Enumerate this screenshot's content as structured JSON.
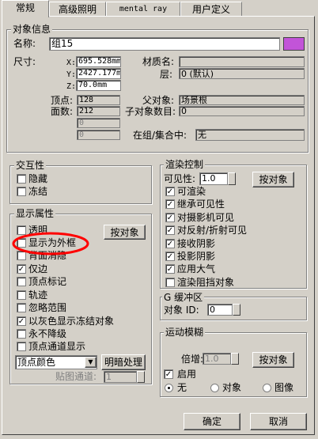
{
  "tabs": [
    "常规",
    "高级照明",
    "mental ray",
    "用户定义"
  ],
  "obj_info": {
    "title": "对象信息",
    "name_label": "名称:",
    "name_value": "组15",
    "swatch_color": "#c254d8",
    "size_label": "尺寸:",
    "x_label": "X:",
    "x_value": "695.528mm",
    "y_label": "Y:",
    "y_value": "2427.177m",
    "z_label": "Z:",
    "z_value": "70.0mm",
    "material_label": "材质名:",
    "material_value": "",
    "layer_label": "层:",
    "layer_value": "0 (默认)",
    "vertices_label": "顶点:",
    "vertices_value": "128",
    "faces_label": "面数:",
    "faces_value": "212",
    "blank1": "0",
    "blank2": "0",
    "parent_label": "父对象:",
    "parent_value": "场景根",
    "children_label": "子对象数目:",
    "children_value": "0",
    "group_label": "在组/集合中:",
    "group_value": "无"
  },
  "interactive": {
    "title": "交互性",
    "hide": "隐藏",
    "freeze": "冻结"
  },
  "display": {
    "title": "显示属性",
    "transparent": "透明",
    "by_object": "按对象",
    "box": "显示为外框",
    "backface": "背面消隐",
    "edges_only": "仅边",
    "vertex_ticks": "顶点标记",
    "trajectory": "轨迹",
    "ignore_extents": "忽略范围",
    "gray_frozen": "以灰色显示冻结对象",
    "never_degrade": "永不降级",
    "vertex_channel": "顶点通道显示",
    "color_select": "顶点颜色",
    "shaded": "明暗处理",
    "map_channel_label": "贴图通道:",
    "map_channel_value": "1"
  },
  "render": {
    "title": "渲染控制",
    "visibility_label": "可见性:",
    "visibility_value": "1.0",
    "by_object": "按对象",
    "items": [
      "可渲染",
      "继承可见性",
      "对摄影机可见",
      "对反射/折射可见",
      "接收阴影",
      "投影阴影",
      "应用大气",
      "渲染阻挡对象"
    ]
  },
  "gbuffer": {
    "title": "G 缓冲区",
    "object_id_label": "对象 ID:",
    "object_id_value": "0"
  },
  "motion": {
    "title": "运动模糊",
    "multiplier_label": "倍增:",
    "multiplier_value": "1.0",
    "by_object": "按对象",
    "enable": "启用",
    "none": "无",
    "object": "对象",
    "image": "图像"
  },
  "ok": "确定",
  "cancel": "取消"
}
